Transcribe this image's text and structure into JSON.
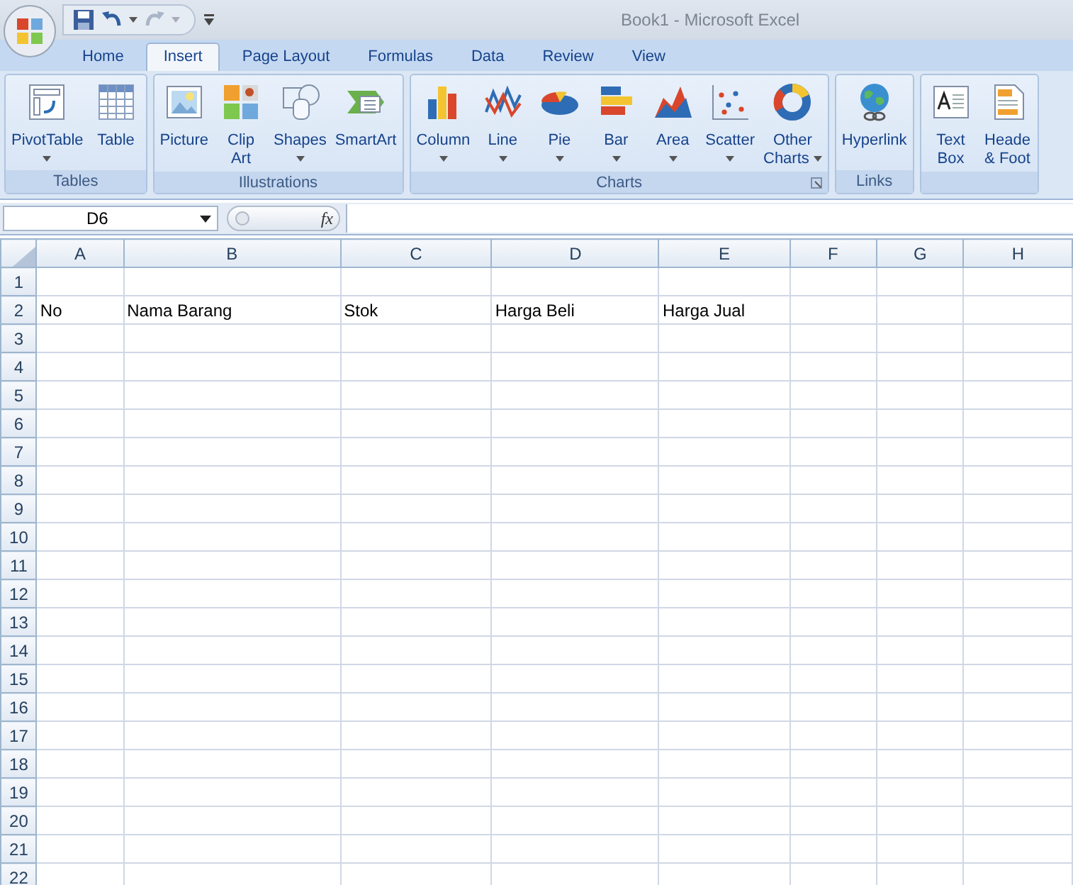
{
  "window": {
    "title": "Book1 - Microsoft Excel"
  },
  "tabs": [
    {
      "label": "Home",
      "selected": false
    },
    {
      "label": "Insert",
      "selected": true
    },
    {
      "label": "Page Layout",
      "selected": false
    },
    {
      "label": "Formulas",
      "selected": false
    },
    {
      "label": "Data",
      "selected": false
    },
    {
      "label": "Review",
      "selected": false
    },
    {
      "label": "View",
      "selected": false
    }
  ],
  "ribbon": [
    {
      "label": "Tables",
      "launcher": false,
      "buttons": [
        {
          "label": "PivotTable",
          "dropdown": true
        },
        {
          "label": "Table",
          "dropdown": false
        }
      ]
    },
    {
      "label": "Illustrations",
      "launcher": false,
      "buttons": [
        {
          "label": "Picture",
          "dropdown": false
        },
        {
          "label": "Clip\nArt",
          "dropdown": false
        },
        {
          "label": "Shapes",
          "dropdown": true
        },
        {
          "label": "SmartArt",
          "dropdown": false
        }
      ]
    },
    {
      "label": "Charts",
      "launcher": true,
      "buttons": [
        {
          "label": "Column",
          "dropdown": true
        },
        {
          "label": "Line",
          "dropdown": true
        },
        {
          "label": "Pie",
          "dropdown": true
        },
        {
          "label": "Bar",
          "dropdown": true
        },
        {
          "label": "Area",
          "dropdown": true
        },
        {
          "label": "Scatter",
          "dropdown": true
        },
        {
          "label": "Other\nCharts",
          "dropdown": true,
          "inline_arrow": true
        }
      ]
    },
    {
      "label": "Links",
      "launcher": false,
      "buttons": [
        {
          "label": "Hyperlink",
          "dropdown": false
        }
      ]
    },
    {
      "buttons": [
        {
          "label": "Text\nBox",
          "dropdown": false
        },
        {
          "label": "Heade\n& Foot",
          "dropdown": false
        }
      ]
    }
  ],
  "formula_bar": {
    "name_box": "D6",
    "function_label": "fx"
  },
  "sheet": {
    "columns": [
      "A",
      "B",
      "C",
      "D",
      "E",
      "F",
      "G",
      "H"
    ],
    "rows": [
      {
        "number": "1"
      },
      {
        "number": "2",
        "cells": [
          "No",
          "Nama Barang",
          "Stok",
          "Harga Beli",
          "Harga Jual"
        ]
      },
      {
        "number": "3"
      },
      {
        "number": "4"
      },
      {
        "number": "5"
      },
      {
        "number": "6"
      },
      {
        "number": "7"
      },
      {
        "number": "8"
      },
      {
        "number": "9"
      },
      {
        "number": "10"
      },
      {
        "number": "11"
      },
      {
        "number": "12"
      },
      {
        "number": "13"
      },
      {
        "number": "14"
      },
      {
        "number": "15"
      },
      {
        "number": "16"
      },
      {
        "number": "17"
      },
      {
        "number": "18"
      },
      {
        "number": "19"
      },
      {
        "number": "20"
      },
      {
        "number": "21"
      },
      {
        "number": "22"
      }
    ]
  }
}
